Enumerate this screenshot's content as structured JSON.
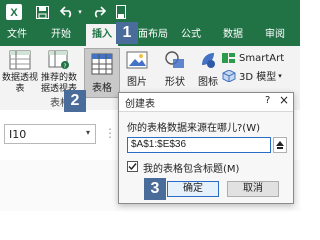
{
  "window": {
    "quick_access": [
      "save-icon",
      "undo-icon",
      "redo-icon",
      "touch-mode-icon"
    ]
  },
  "ribbon": {
    "tabs": [
      {
        "label": "文件"
      },
      {
        "label": "开始"
      },
      {
        "label": "插入",
        "active": true
      },
      {
        "label": "页面布局"
      },
      {
        "label": "公式"
      },
      {
        "label": "数据"
      },
      {
        "label": "审阅"
      }
    ],
    "buttons": {
      "pivot_table": "数据透视表",
      "recommended_pivot": "推荐的数据透视表",
      "table": "表格",
      "picture": "图片",
      "shapes": "形状",
      "icons": "图标",
      "smartart": "SmartArt",
      "model_3d": "3D 模型"
    },
    "group_label": "表格"
  },
  "formula_bar": {
    "name_box": "I10"
  },
  "dialog": {
    "title": "创建表",
    "close_glyph": "×",
    "prompt": "你的表格数据来源在哪儿?(W)",
    "range_value": "$A$1:$E$36",
    "header_checkbox_label": "我的表格包含标题(M)",
    "header_checked": true,
    "ok_label": "确定",
    "cancel_label": "取消"
  },
  "steps": [
    "1",
    "2",
    "3"
  ],
  "colors": {
    "excel_green": "#217346",
    "step_badge": "#4a6c9b",
    "ok_border": "#2b6cc4"
  }
}
